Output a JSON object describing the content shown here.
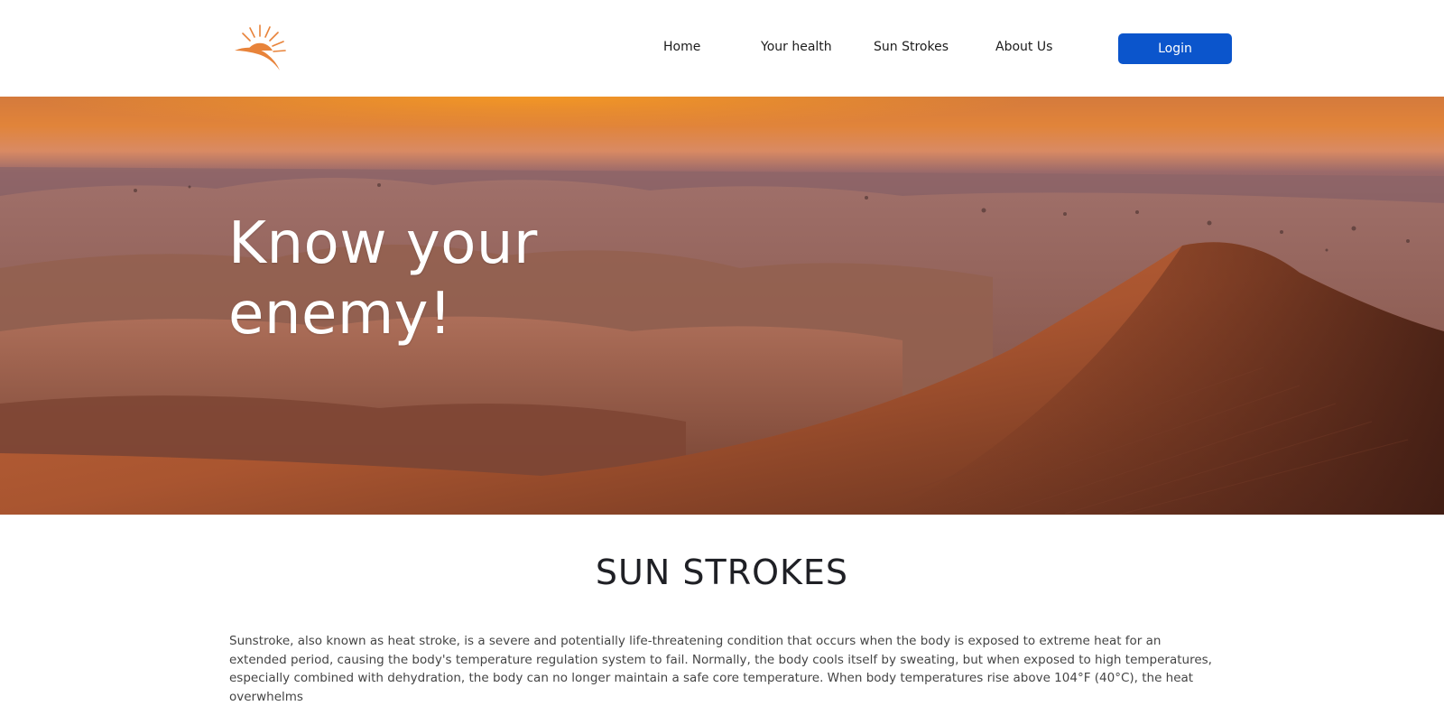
{
  "header": {
    "logo_icon": "sun-rising-logo-icon",
    "brand_color": "#e8833a",
    "nav": {
      "home": "Home",
      "your_health": "Your health",
      "sun_strokes": "Sun Strokes",
      "about_us": "About Us"
    },
    "login_label": "Login",
    "login_color": "#0b55cc"
  },
  "hero": {
    "title": "Know your enemy!"
  },
  "section": {
    "title": "SUN STROKES",
    "body": "Sunstroke, also known as heat stroke, is a severe and potentially life-threatening condition that occurs when the body is exposed to extreme heat for an extended period, causing the body's temperature regulation system to fail. Normally, the body cools itself by sweating, but when exposed to high temperatures, especially combined with dehydration, the body can no longer maintain a safe core temperature. When body temperatures rise above 104°F (40°C), the heat overwhelms"
  }
}
